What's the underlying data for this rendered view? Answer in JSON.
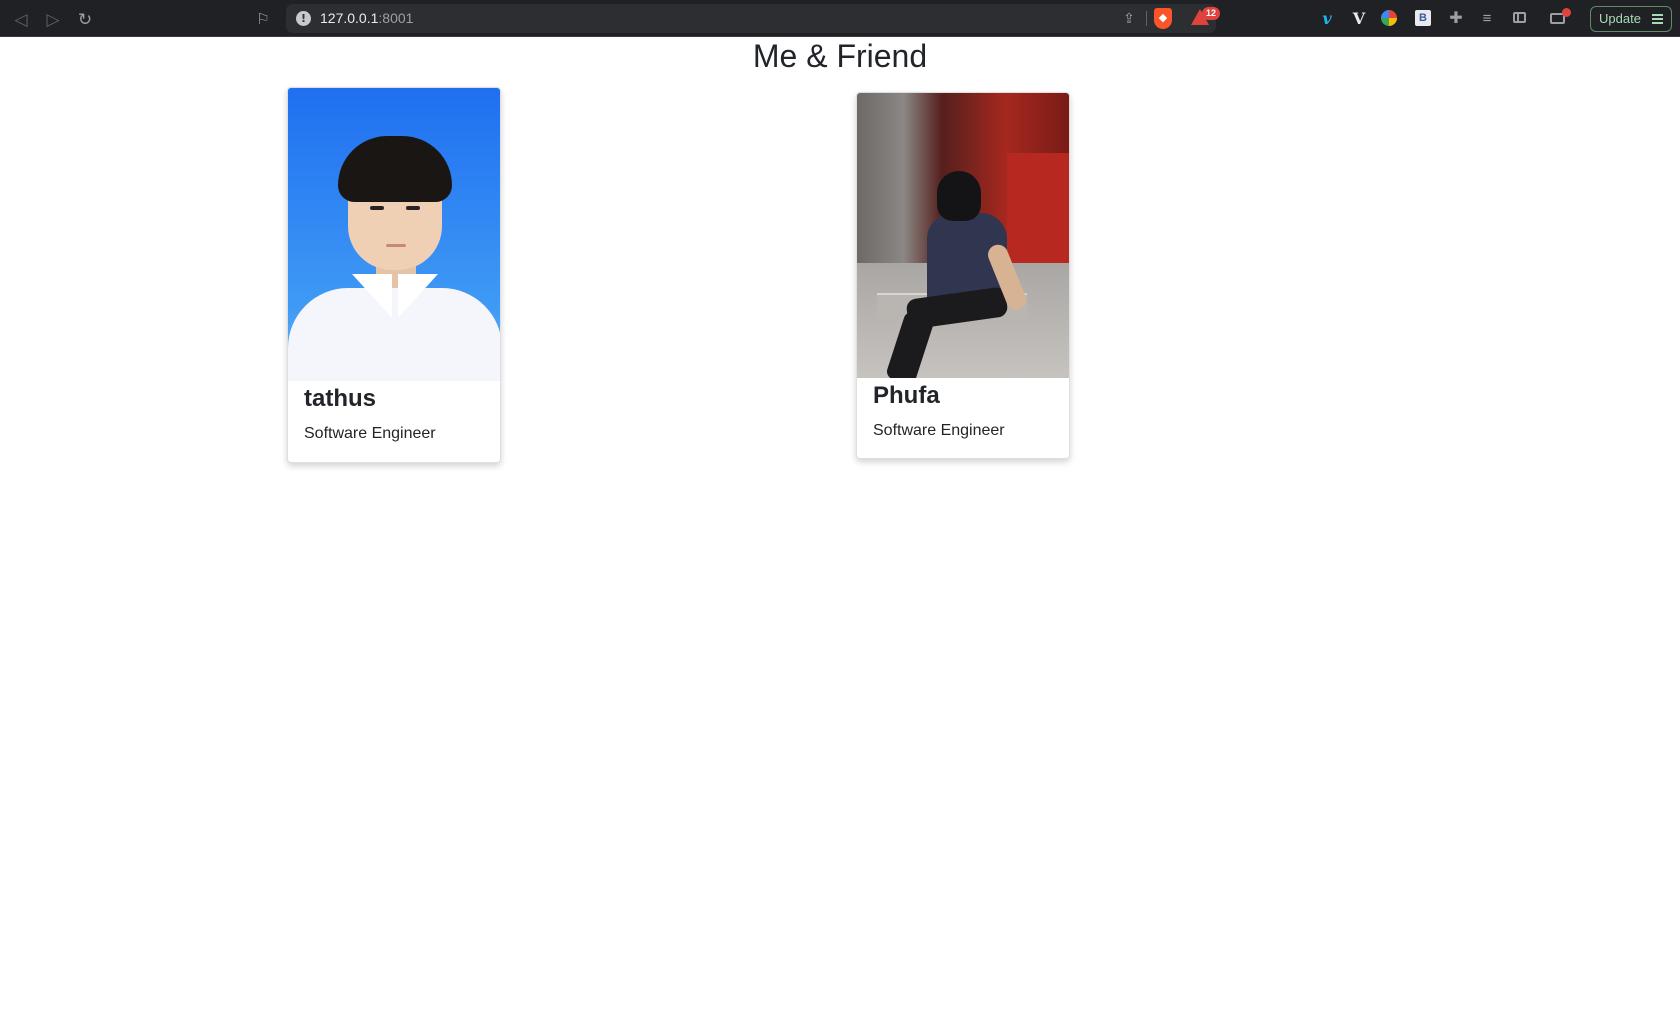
{
  "browser": {
    "url_host": "127.0.0.1",
    "url_port": ":8001",
    "rewards_badge": "12",
    "update_label": "Update"
  },
  "page": {
    "title": "Me & Friend",
    "cards": [
      {
        "name": "tathus",
        "role": "Software Engineer"
      },
      {
        "name": "Phufa",
        "role": "Software Engineer"
      }
    ]
  },
  "colors": {
    "toolbar_bg": "#202124",
    "page_bg": "#ffffff",
    "text": "#212529",
    "brave_orange": "#fb542b"
  }
}
